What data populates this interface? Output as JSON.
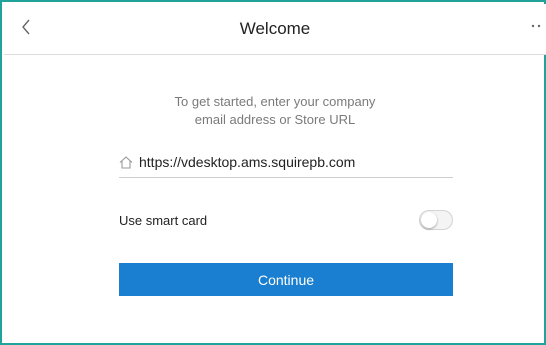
{
  "header": {
    "title": "Welcome",
    "back_icon": "chevron-left-icon",
    "more_icon": "more-dots-icon"
  },
  "intro": {
    "line1": "To get started, enter your company",
    "line2": "email address or Store URL"
  },
  "url_field": {
    "icon": "home-icon",
    "value": "https://vdesktop.ams.squirepb.com"
  },
  "smart_card": {
    "label": "Use smart card",
    "enabled": false
  },
  "continue_button": {
    "label": "Continue"
  },
  "colors": {
    "frame_border": "#1fa39a",
    "primary_button": "#1a7fd0",
    "intro_text": "#7a7a7a"
  }
}
